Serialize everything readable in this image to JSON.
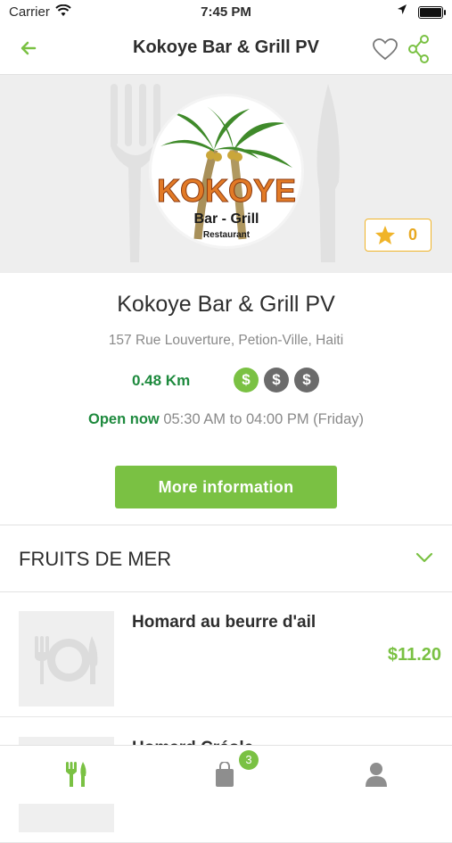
{
  "status_bar": {
    "carrier": "Carrier",
    "time": "7:45 PM"
  },
  "nav": {
    "title": "Kokoye Bar & Grill PV"
  },
  "hero": {
    "rating_count": "0"
  },
  "restaurant": {
    "name": "Kokoye Bar & Grill PV",
    "address": "157 Rue Louverture, Petion-Ville, Haiti",
    "distance": "0.48 Km",
    "price_symbol": "$",
    "price_level": 1,
    "price_max": 3,
    "open_label": "Open now",
    "hours": "05:30 AM to 04:00 PM (Friday)",
    "more_info_label": "More information"
  },
  "menu": {
    "section_title": "FRUITS DE MER",
    "items": [
      {
        "name": "Homard au beurre d'ail",
        "price": "$11.20"
      },
      {
        "name": "Homard Créole",
        "price": ""
      }
    ]
  },
  "tabbar": {
    "cart_badge": "3"
  },
  "colors": {
    "accent_green": "#7ac143",
    "dark_green": "#1e8a3e",
    "star": "#f0b429"
  }
}
